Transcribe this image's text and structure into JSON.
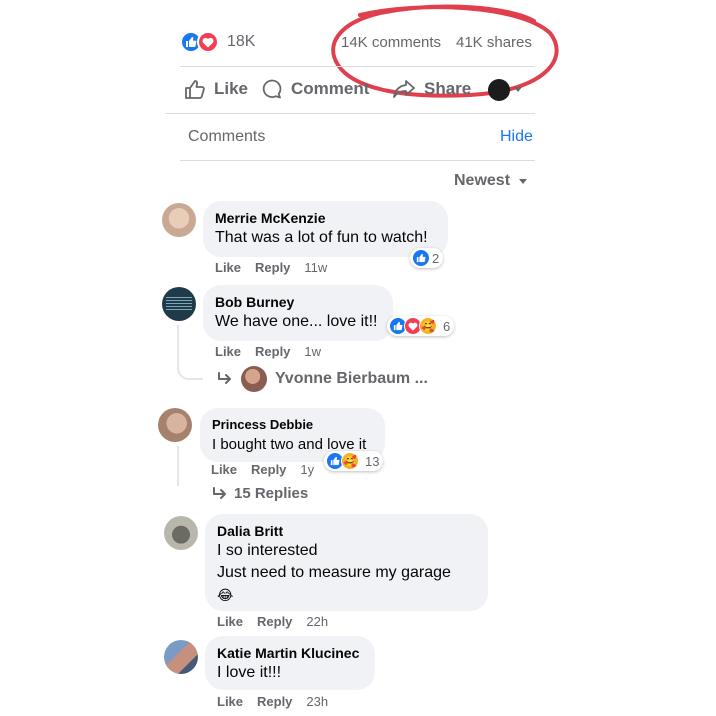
{
  "post": {
    "reactions_count": "18K",
    "comments_count": "14K comments",
    "shares_count": "41K shares",
    "annotation_color": "#e0404e"
  },
  "actions": {
    "like": "Like",
    "comment": "Comment",
    "share": "Share"
  },
  "comments_header": {
    "title": "Comments",
    "hide": "Hide",
    "sort": "Newest"
  },
  "comments": [
    {
      "name": "Merrie McKenzie",
      "text": "That was a lot of fun to watch!",
      "like": "Like",
      "reply": "Reply",
      "time": "11w",
      "reaction_count": "2"
    },
    {
      "name": "Bob Burney",
      "text": "We have one... love it!!",
      "like": "Like",
      "reply": "Reply",
      "time": "1w",
      "reaction_count": "6",
      "reply_preview": "Yvonne Bierbaum ..."
    },
    {
      "name": "Princess Debbie",
      "text": "I bought two and love it",
      "like": "Like",
      "reply": "Reply",
      "time": "1y",
      "reaction_count": "13",
      "replies": "15 Replies"
    },
    {
      "name": "Dalia Britt",
      "text_line1": "I so interested",
      "text_line2": "Just need to measure my garage",
      "emoji": "😂",
      "like": "Like",
      "reply": "Reply",
      "time": "22h"
    },
    {
      "name": "Katie Martin Klucinec",
      "text": "I love it!!!",
      "like": "Like",
      "reply": "Reply",
      "time": "23h"
    }
  ]
}
